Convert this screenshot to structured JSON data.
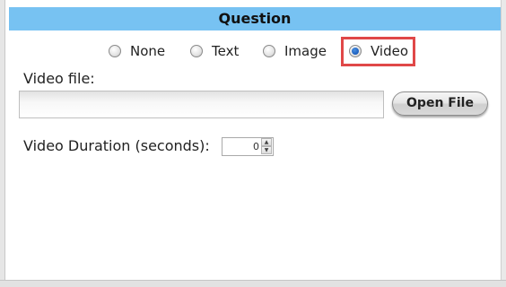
{
  "header": {
    "title": "Question"
  },
  "media_type": {
    "options": [
      {
        "label": "None",
        "checked": false
      },
      {
        "label": "Text",
        "checked": false
      },
      {
        "label": "Image",
        "checked": false
      },
      {
        "label": "Video",
        "checked": true
      }
    ],
    "highlight_color": "#e04848"
  },
  "video_file": {
    "label": "Video file:",
    "value": "",
    "open_button_label": "Open File"
  },
  "duration": {
    "label": "Video Duration (seconds):",
    "value": "0",
    "up_glyph": "▲",
    "down_glyph": "▼"
  },
  "colors": {
    "header_bg": "#77c2f2",
    "radio_selected": "#1356b8"
  }
}
